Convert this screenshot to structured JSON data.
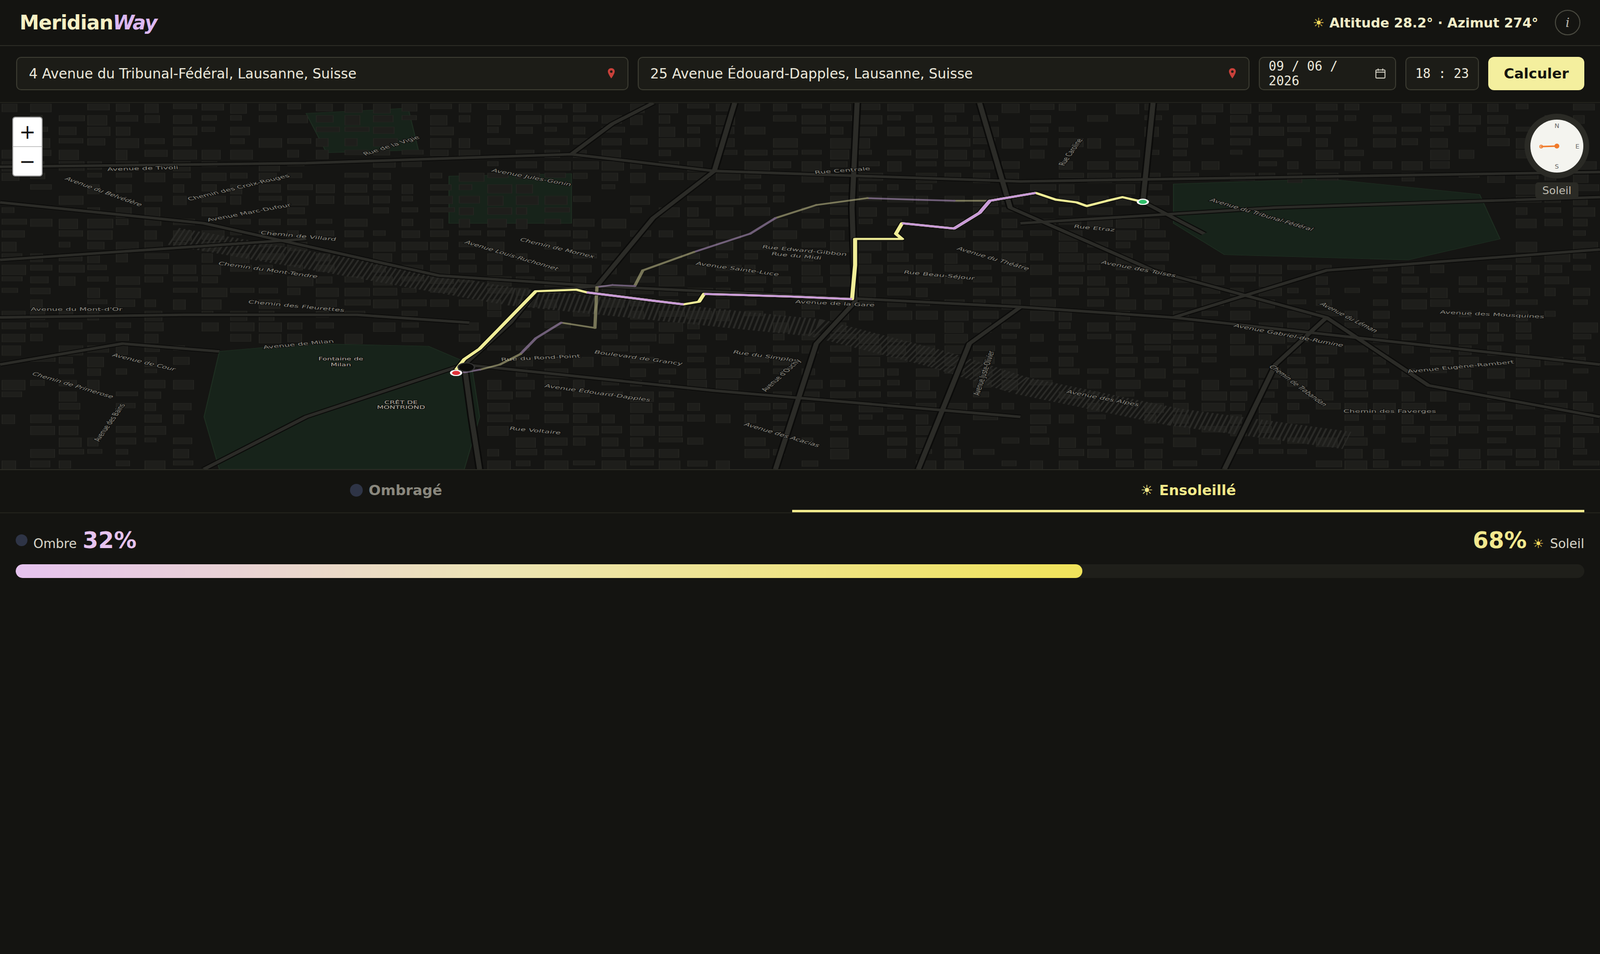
{
  "header": {
    "logo": {
      "primary": "Meridian",
      "accent": "Way"
    },
    "sun_icon": "☀",
    "sun_info": "Altitude 28.2° · Azimut 274°",
    "info_button": "i"
  },
  "form": {
    "origin": "4 Avenue du Tribunal-Fédéral, Lausanne, Suisse",
    "destination": "25 Avenue Édouard-Dapples, Lausanne, Suisse",
    "date": "09 / 06 / 2026",
    "time": "18 : 23",
    "submit": "Calculer"
  },
  "map": {
    "zoom_in": "+",
    "zoom_out": "−",
    "compass": {
      "n": "N",
      "e": "E",
      "s": "S",
      "label": "Soleil"
    },
    "labels": [
      "Avenue de Tivoli",
      "Avenue du Belvédère",
      "Avenue Marc-Dufour",
      "Chemin des Croix-Rouges",
      "Avenue Jules-Gonin",
      "Avenue Louis-Ruchonnet",
      "Chemin de Villard",
      "Chemin de Mornex",
      "Rue de la Vigie",
      "Rue Centrale",
      "Rue Edward-Gibbon",
      "Rue du Midi",
      "Avenue Sainte-Luce",
      "Rue Beau-Séjour",
      "Avenue de la Gare",
      "Avenue du Théâtre",
      "Rue Caroline",
      "Rue Etraz",
      "Avenue des Toises",
      "Avenue du Tribunal-Fédéral",
      "Avenue du Léman",
      "Avenue Gabriel-de-Rumine",
      "Avenue des Mousquines",
      "Avenue Eugène-Rambert",
      "Chemin de Trabandan",
      "Chemin des Faverges",
      "Boulevard de Grancy",
      "Rue du Simplon",
      "Avenue d'Ouchy",
      "Rue du Rond-Point",
      "Avenue Édouard-Dapples",
      "Chemin du Mont-Tendre",
      "Chemin des Fleurettes",
      "Avenue du Mont-d'Or",
      "Avenue de Milan",
      "Avenue de Cour",
      "Rue Voltaire",
      "Avenue des Acacias",
      "Avenue Juste-Olivier",
      "Avenue des Alpes",
      "Chemin de Primerose",
      "Avenue des Bains",
      "Fontaine de",
      "Milan",
      "CRÊT DE",
      "MONTRIOND"
    ]
  },
  "tabs": [
    {
      "label": "Ombragé",
      "kind": "shade",
      "icon": "",
      "selected": false
    },
    {
      "label": "Ensoleillé",
      "kind": "sun",
      "icon": "☀",
      "selected": true
    }
  ],
  "summary": {
    "shade_label": "Ombre",
    "shade_value": "32%",
    "sun_value": "68%",
    "sun_icon": "☀",
    "sun_label": "Soleil",
    "level": 0.68
  }
}
